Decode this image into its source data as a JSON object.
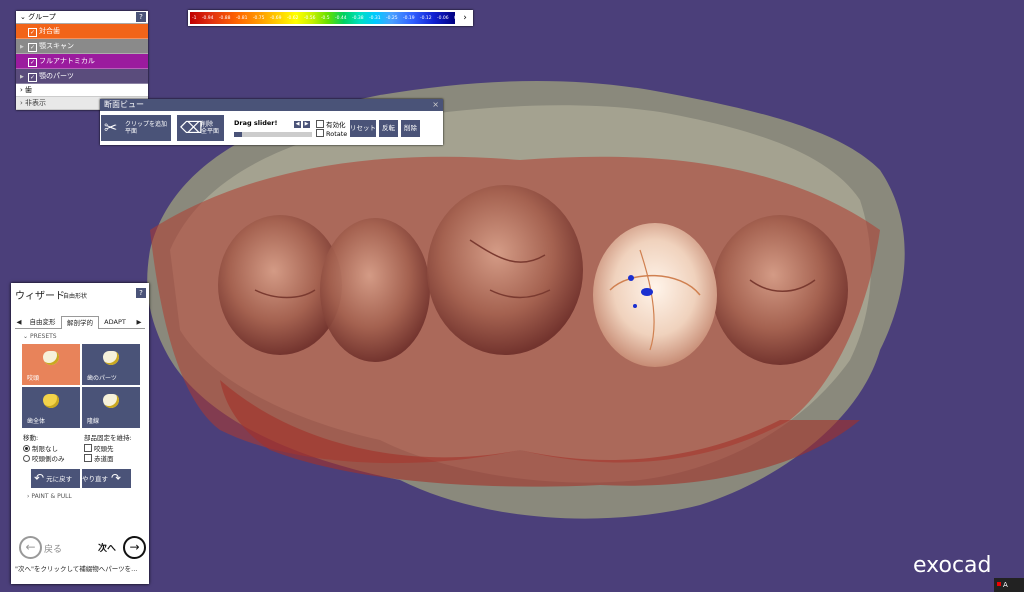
{
  "color_scale": {
    "labels": [
      "-1",
      "-0.94",
      "-0.88",
      "-0.81",
      "-0.75",
      "-0.69",
      "-0.62",
      "-0.56",
      "-0.5",
      "-0.44",
      "-0.38",
      "-0.31",
      "-0.25",
      "-0.19",
      "-0.12",
      "-0.06",
      "0"
    ],
    "arrow": "›"
  },
  "groups": {
    "title": "グループ",
    "help": "?",
    "items": [
      {
        "label": "対合歯",
        "color": "#f26419"
      },
      {
        "label": "顎スキャン",
        "color": "#8a8a8a"
      },
      {
        "label": "フルアナトミカル",
        "color": "#9b1b9e"
      },
      {
        "label": "顎のパーツ",
        "color": "#5a4c7c"
      }
    ],
    "tooth": "歯",
    "hidden": "非表示"
  },
  "section_view": {
    "title": "断面ビュー",
    "close": "×",
    "add_clip_line1": "クリップを追加",
    "add_clip_line2": "平面",
    "delete_line1": "削除",
    "delete_line2": "全平面",
    "slider_label": "Drag slider!",
    "enable": "有効化",
    "rotate": "Rotate",
    "reset": "リセット",
    "flip": "反転",
    "delete": "削除"
  },
  "wizard": {
    "title": "ウィザード",
    "subtitle": "自由形状",
    "help": "?",
    "tabs": [
      "自由変形",
      "解剖学的",
      "ADAPT"
    ],
    "presets_label": "PRESETS",
    "presets": [
      "咬頭",
      "歯のパーツ",
      "歯全体",
      "隆線"
    ],
    "move_label": "移動:",
    "move_options": [
      "制限なし",
      "咬頭側のみ"
    ],
    "keep_label": "部品固定を維持:",
    "keep_options": [
      "咬頭先",
      "赤道面"
    ],
    "undo": "元に戻す",
    "redo": "やり直す",
    "paint_pull": "PAINT & PULL",
    "back": "戻る",
    "next": "次へ",
    "hint": "\"次へ\"をクリックして補綴物へパーツを..."
  },
  "logo": "exocad",
  "tray": "A"
}
